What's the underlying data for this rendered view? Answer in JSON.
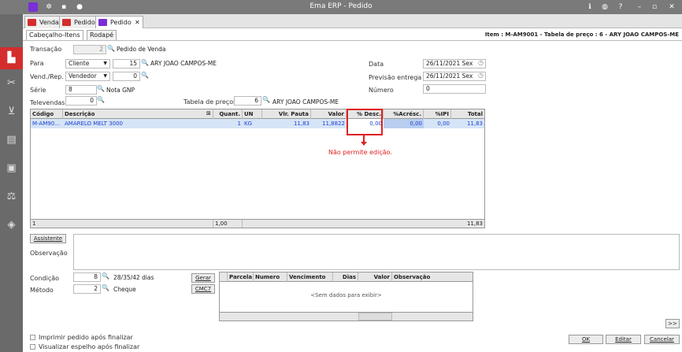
{
  "window": {
    "title": "Ema ERP - Pedido"
  },
  "tabs": [
    {
      "label": "Vendas"
    },
    {
      "label": "Pedidos"
    },
    {
      "label": "Pedido"
    }
  ],
  "subtabs": [
    {
      "label": "Cabeçalho-Itens"
    },
    {
      "label": "Rodapé"
    }
  ],
  "item_info": "Item : M-AM9001 - Tabela de preço : 6 - ARY JOAO CAMPOS-ME",
  "form": {
    "transacao": {
      "label": "Transação",
      "value": "2",
      "desc": "Pedido de Venda"
    },
    "para": {
      "label": "Para",
      "select": "Cliente",
      "value": "15",
      "desc": "ARY JOAO CAMPOS-ME"
    },
    "vend": {
      "label": "Vend./Rep.",
      "select": "Vendedor",
      "value": "0"
    },
    "serie": {
      "label": "Série",
      "value": "8",
      "desc": "Nota GNP"
    },
    "televendas": {
      "label": "Televendas",
      "value": "0"
    },
    "tabela": {
      "label": "Tabela de preços",
      "value": "6",
      "desc": "ARY JOAO CAMPOS-ME"
    },
    "data": {
      "label": "Data",
      "value": "26/11/2021 Sex"
    },
    "previsao": {
      "label": "Previsão entrega",
      "value": "26/11/2021 Sex"
    },
    "numero": {
      "label": "Número",
      "value": "0"
    }
  },
  "grid": {
    "headers": [
      "Código",
      "Descrição",
      "Quant.",
      "UN",
      "Vlr. Pauta",
      "Valor",
      "% Desc.",
      "%Acrésc.",
      "%IPI",
      "Total"
    ],
    "row": [
      "M-AM90...",
      "AMARELO MELT 3000",
      "1",
      "KG",
      "11,83",
      "11,8822",
      "0,00",
      "0,00",
      "0,00",
      "11,83"
    ],
    "footer": {
      "count": "1",
      "quant": "1,00",
      "total": "11,83"
    }
  },
  "annotation": "Não permite edição.",
  "buttons": {
    "assistente": "Assistente",
    "gerar": "Gerar",
    "cmc7": "CMC7",
    "more": ">>",
    "ok": "OK",
    "editar": "Editar",
    "cancelar": "Cancelar"
  },
  "observacao_label": "Observação",
  "condicao": {
    "label": "Condição",
    "value": "8",
    "desc": "28/35/42 dias"
  },
  "metodo": {
    "label": "Método",
    "value": "2",
    "desc": "Cheque"
  },
  "parcelas": {
    "headers": [
      "Parcela",
      "Numero",
      "Vencimento",
      "Dias",
      "Valor",
      "Observação"
    ],
    "empty": "<Sem dados para exibir>"
  },
  "checks": {
    "imprimir": "Imprimir pedido após finalizar",
    "visualizar": "Visualizar espelho após finalizar"
  },
  "colors": {
    "accent": "#d42d2d",
    "highlight": "#e02020",
    "row": "#d6e4f7"
  }
}
